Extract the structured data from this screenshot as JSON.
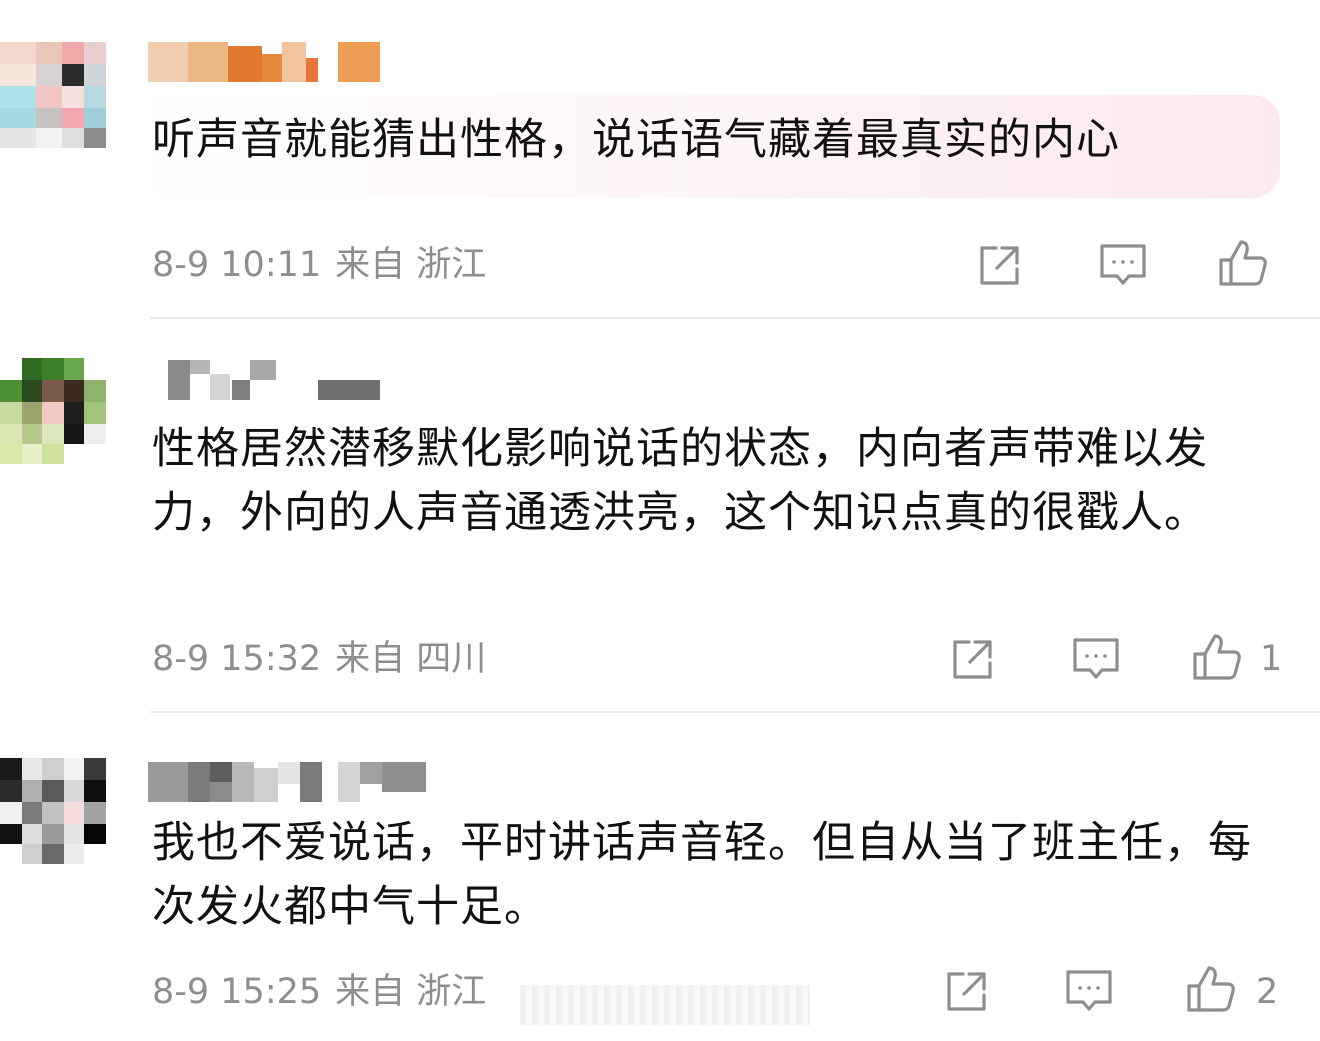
{
  "comments": [
    {
      "text": "听声音就能猜出性格，说话语气藏着最真实的内心",
      "date": "8-9 10:11",
      "location": "来自 浙江",
      "likes": ""
    },
    {
      "text": "性格居然潜移默化影响说话的状态，内向者声带难以发力，外向的人声音通透洪亮，这个知识点真的很戳人。",
      "date": "8-9 15:32",
      "location": "来自 四川",
      "likes": "1"
    },
    {
      "text": "我也不爱说话，平时讲话声音轻。但自从当了班主任，每次发火都中气十足。",
      "date": "8-9 15:25",
      "location": "来自 浙江",
      "likes": "2"
    }
  ],
  "icons": {
    "share": "share-icon",
    "comment": "comment-icon",
    "like": "thumbs-up-icon"
  },
  "colors": {
    "text": "#111111",
    "meta": "#8e8e8e",
    "icon": "#8e8e8e",
    "highlight": "#fbe9ee"
  }
}
